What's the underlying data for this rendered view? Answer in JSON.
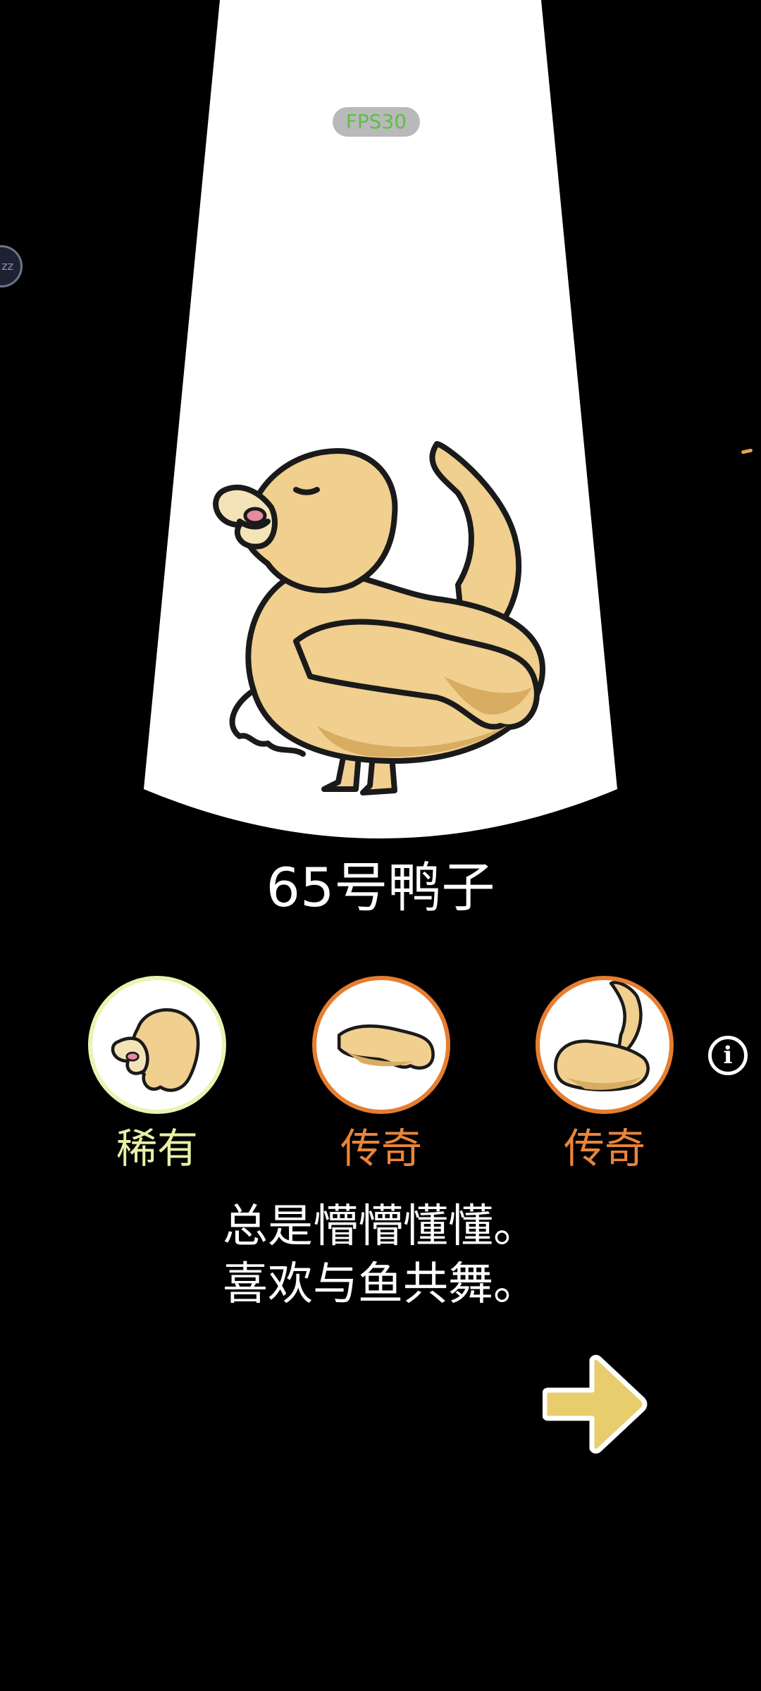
{
  "overlay": {
    "fps_label": "FPS30",
    "sleep_label": "zz"
  },
  "duck": {
    "name": "65号鸭子",
    "description_lines": [
      "总是懵懵懂懂。",
      "喜欢与鱼共舞。"
    ],
    "body_color": "#f0cf8f"
  },
  "parts": [
    {
      "rarity": "稀有",
      "part": "head",
      "ring_color": "#eaf3b2",
      "label_color": "#e8f0a6"
    },
    {
      "rarity": "传奇",
      "part": "wing",
      "ring_color": "#e67d30",
      "label_color": "#e8853a"
    },
    {
      "rarity": "传奇",
      "part": "body-tail",
      "ring_color": "#e67d30",
      "label_color": "#e8853a"
    }
  ],
  "icons": {
    "info": "info-icon",
    "next": "right-arrow-icon"
  },
  "colors": {
    "background": "#000000",
    "spotlight": "#ffffff",
    "arrow": "#e8cd6c"
  }
}
